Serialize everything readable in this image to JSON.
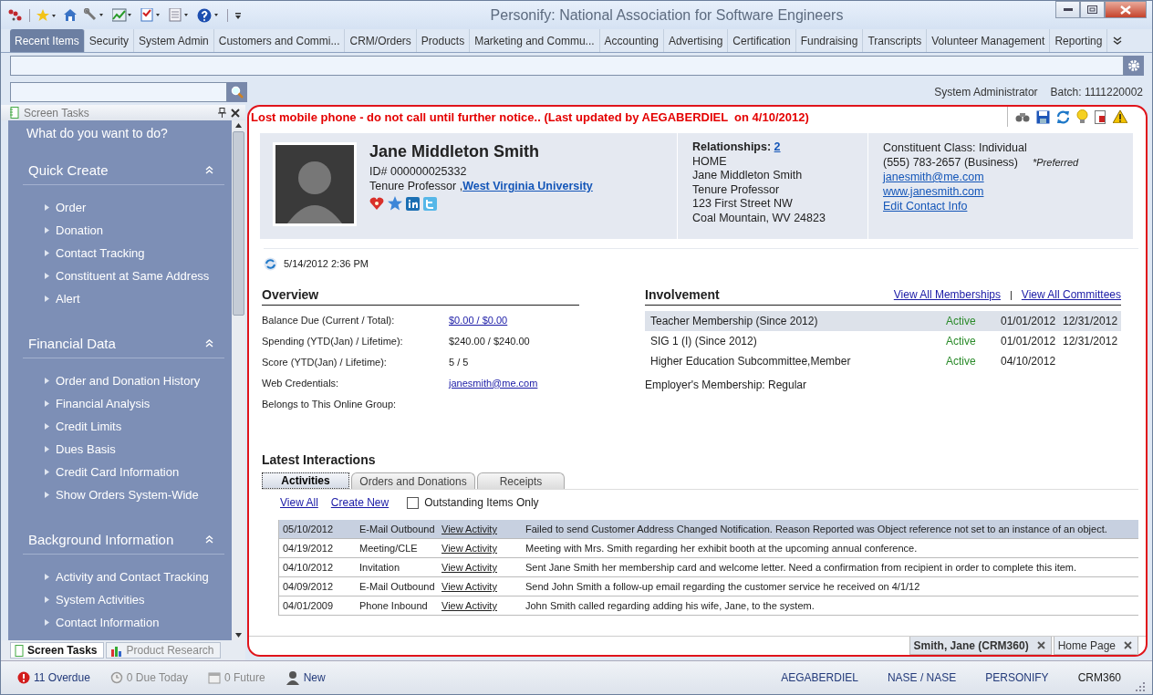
{
  "window": {
    "title": "Personify: National Association for Software Engineers"
  },
  "tabs": [
    {
      "label": "Recent Items",
      "selected": true
    },
    {
      "label": "Security",
      "selected": false
    },
    {
      "label": "System Admin",
      "selected": false
    },
    {
      "label": "Customers and Commi...",
      "selected": false
    },
    {
      "label": "CRM/Orders",
      "selected": false
    },
    {
      "label": "Products",
      "selected": false
    },
    {
      "label": "Marketing and Commu...",
      "selected": false
    },
    {
      "label": "Accounting",
      "selected": false
    },
    {
      "label": "Advertising",
      "selected": false
    },
    {
      "label": "Certification",
      "selected": false
    },
    {
      "label": "Fundraising",
      "selected": false
    },
    {
      "label": "Transcripts",
      "selected": false
    },
    {
      "label": "Volunteer Management",
      "selected": false
    },
    {
      "label": "Reporting",
      "selected": false
    }
  ],
  "user_bar": {
    "user": "System Administrator",
    "batch": "Batch: 1111220002"
  },
  "screen_tasks": {
    "title": "Screen Tasks",
    "prompt": "What do you want to do?",
    "sections": [
      {
        "title": "Quick Create",
        "expanded": true,
        "items": [
          "Order",
          "Donation",
          "Contact Tracking",
          "Constituent at Same Address",
          "Alert"
        ]
      },
      {
        "title": "Financial Data",
        "expanded": true,
        "items": [
          "Order and Donation History",
          "Financial Analysis",
          "Credit Limits",
          "Dues Basis",
          "Credit Card Information",
          "Show Orders System-Wide"
        ]
      },
      {
        "title": "Background Information",
        "expanded": true,
        "items": [
          "Activity and Contact Tracking",
          "System Activities",
          "Contact Information"
        ]
      }
    ],
    "bottom_tabs": [
      {
        "label": "Screen Tasks",
        "selected": true
      },
      {
        "label": "Product Research",
        "selected": false
      }
    ]
  },
  "record": {
    "alert": "Lost mobile phone - do not call until further notice.. (Last updated by AEGABERDIEL  on 4/10/2012)",
    "profile": {
      "name": "Jane Middleton Smith",
      "id": "ID# 000000025332",
      "title": "Tenure Professor ,",
      "organization": "West Virginia University"
    },
    "relationships": {
      "label": "Relationships:",
      "count": "2",
      "lines": [
        "HOME",
        "Jane Middleton Smith",
        "Tenure Professor",
        "123 First Street NW",
        "Coal Mountain, WV 24823"
      ]
    },
    "contact": {
      "class": "Constituent Class: Individual",
      "phone": "(555) 783-2657 (Business)",
      "preferred": "*Preferred",
      "links": [
        "janesmith@me.com",
        "www.janesmith.com",
        "Edit Contact Info"
      ]
    },
    "updated": "5/14/2012 2:36 PM",
    "overview": {
      "title": "Overview",
      "rows": [
        {
          "label": "Balance Due (Current / Total):",
          "value": "$0.00 / $0.00",
          "kind": "link"
        },
        {
          "label": "Spending (YTD(Jan) / Lifetime):",
          "value": "$240.00 / $240.00",
          "kind": "text"
        },
        {
          "label": "Score (YTD(Jan) / Lifetime):",
          "value": "5 / 5",
          "kind": "text"
        },
        {
          "label": "Web Credentials:",
          "value": "janesmith@me.com",
          "kind": "link"
        },
        {
          "label": "Belongs to This Online Group:"
        }
      ]
    },
    "involvement": {
      "title": "Involvement",
      "links": [
        "View All Memberships",
        "View All Committees"
      ],
      "separator": "|",
      "rows": [
        {
          "name": "Teacher Membership (Since 2012)",
          "status": "Active",
          "start": "01/01/2012",
          "end": "12/31/2012",
          "selected": true
        },
        {
          "name": "SIG 1 (I) (Since 2012)",
          "status": "Active",
          "start": "01/01/2012",
          "end": "12/31/2012",
          "selected": false
        },
        {
          "name": "Higher Education Subcommittee,Member",
          "status": "Active",
          "start": "04/10/2012",
          "selected": false
        }
      ],
      "employer": "Employer's Membership: Regular"
    },
    "interactions": {
      "title": "Latest Interactions",
      "tabs": [
        {
          "label": "Activities",
          "selected": true
        },
        {
          "label": "Orders and Donations",
          "selected": false
        },
        {
          "label": "Receipts",
          "selected": false
        }
      ],
      "links": [
        "View All",
        "Create New"
      ],
      "outstanding": {
        "label": "Outstanding Items Only",
        "checked": false
      },
      "rows": [
        {
          "date": "05/10/2012",
          "type": "E-Mail Outbound",
          "link": "View Activity",
          "description": "Failed to send Customer Address Changed Notification. Reason Reported was Object reference not set to an instance of an object.",
          "selected": true
        },
        {
          "date": "04/19/2012",
          "type": "Meeting/CLE",
          "link": "View Activity",
          "description": "Meeting with Mrs. Smith regarding her exhibit booth at the upcoming annual conference.",
          "selected": false
        },
        {
          "date": "04/10/2012",
          "type": "Invitation",
          "link": "View Activity",
          "description": "Sent Jane Smith her membership card and welcome letter. Need a confirmation from recipient in order to complete this item.",
          "selected": false
        },
        {
          "date": "04/09/2012",
          "type": "E-Mail Outbound",
          "link": "View Activity",
          "description": "Send John Smith a follow-up email regarding the customer service he received on 4/1/12",
          "selected": false
        },
        {
          "date": "04/01/2009",
          "type": "Phone Inbound",
          "link": "View Activity",
          "description": "John Smith called regarding adding his wife, Jane, to the system.",
          "selected": false
        }
      ]
    }
  },
  "document_tabs": [
    {
      "label": "Smith, Jane (CRM360)",
      "selected": true
    },
    {
      "label": "Home Page",
      "selected": false
    }
  ],
  "status_bar": {
    "left": [
      {
        "kind": "overdue",
        "text": "11 Overdue",
        "disabled": false
      },
      {
        "kind": "today",
        "text": "0 Due Today",
        "disabled": true
      },
      {
        "kind": "future",
        "text": "0 Future",
        "disabled": true
      },
      {
        "kind": "new",
        "text": "New",
        "disabled": false
      }
    ],
    "right": [
      "AEGABERDIEL",
      "NASE / NASE",
      "PERSONIFY",
      "CRM360"
    ]
  }
}
